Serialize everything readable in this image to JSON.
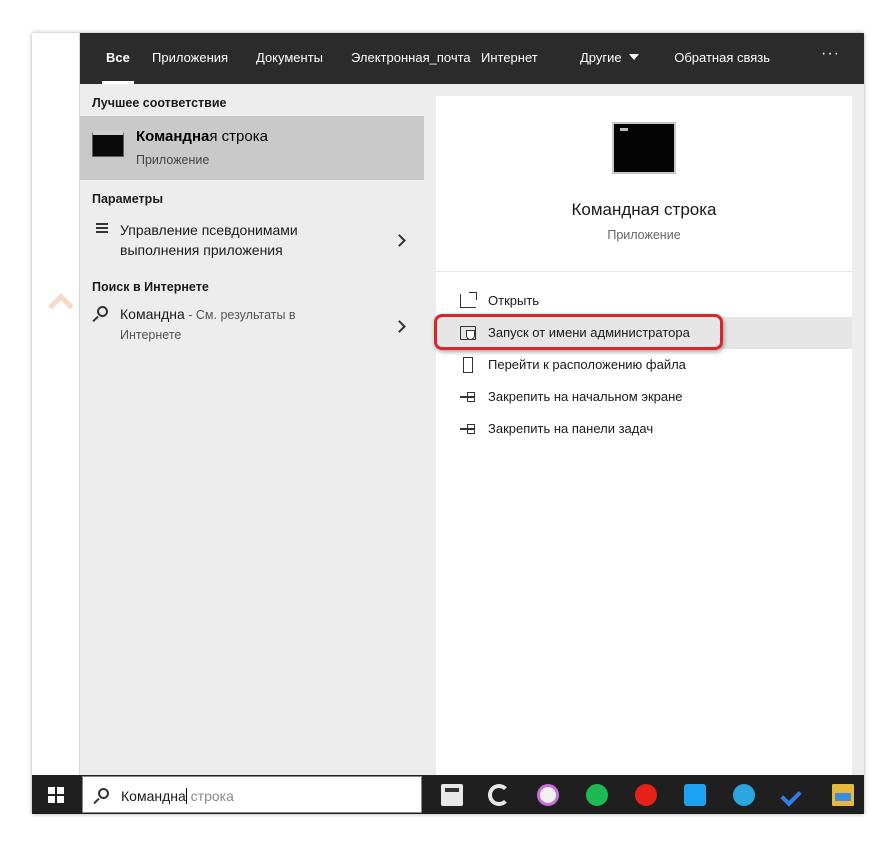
{
  "tabs": {
    "all": "Все",
    "apps": "Приложения",
    "documents": "Документы",
    "email": "Электронная_почта",
    "internet": "Интернет",
    "other": "Другие"
  },
  "feedback": "Обратная связь",
  "more": "···",
  "left": {
    "best_match_header": "Лучшее соответствие",
    "best_match": {
      "title_bold": "Командна",
      "title_rest": "я строка",
      "subtitle": "Приложение"
    },
    "settings_header": "Параметры",
    "settings_item": {
      "line1": "Управление псевдонимами",
      "line2": "выполнения приложения"
    },
    "web_header": "Поиск в Интернете",
    "web_item": {
      "query": "Командна",
      "hint_line1": " - См. результаты в",
      "hint_line2": "Интернете"
    }
  },
  "right": {
    "app_title": "Командная строка",
    "app_subtitle": "Приложение",
    "actions": [
      {
        "label": "Открыть",
        "icon": "open-icon"
      },
      {
        "label": "Запуск от имени администратора",
        "icon": "run-as-admin-icon"
      },
      {
        "label": "Перейти к расположению файла",
        "icon": "file-location-icon"
      },
      {
        "label": "Закрепить на начальном экране",
        "icon": "pin-icon"
      },
      {
        "label": "Закрепить на панели задач",
        "icon": "pin-icon"
      }
    ],
    "highlight_color": "#d7272d"
  },
  "taskbar": {
    "search_typed": "Командна",
    "search_placeholder_rest": " строка",
    "apps": [
      "calculator-icon",
      "edge-icon",
      "itunes-icon",
      "spotify-icon",
      "youtube-icon",
      "twitter-icon",
      "telegram-icon",
      "todo-icon",
      "file-explorer-icon"
    ]
  }
}
